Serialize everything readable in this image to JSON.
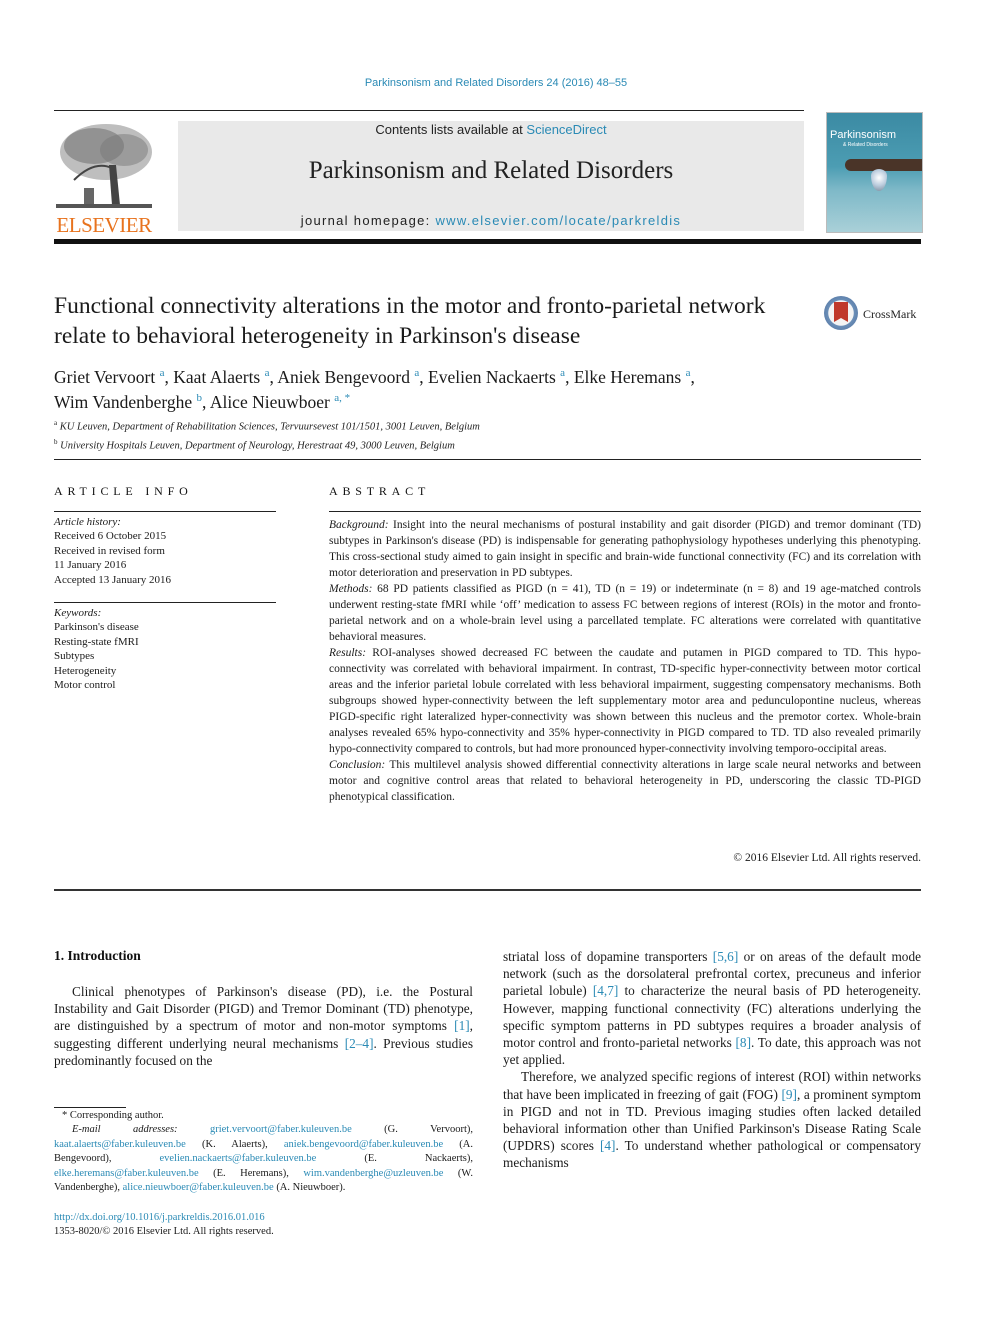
{
  "header": {
    "journal_ref": "Parkinsonism and Related Disorders 24 (2016) 48–55",
    "contents_prefix": "Contents lists available at ",
    "contents_link": "ScienceDirect",
    "journal_title": "Parkinsonism and Related Disorders",
    "homepage_prefix": "journal homepage: ",
    "homepage_link": "www.elsevier.com/locate/parkreldis",
    "publisher_logo_text": "ELSEVIER",
    "cover_title": "Parkinsonism",
    "cover_subtitle": "& Related Disorders"
  },
  "article": {
    "title": "Functional connectivity alterations in the motor and fronto-parietal network relate to behavioral heterogeneity in Parkinson's disease",
    "crossmark_label": "CrossMark",
    "authors": [
      {
        "name": "Griet Vervoort",
        "aff": "a",
        "sep": ", "
      },
      {
        "name": "Kaat Alaerts",
        "aff": "a",
        "sep": ", "
      },
      {
        "name": "Aniek Bengevoord",
        "aff": "a",
        "sep": ", "
      },
      {
        "name": "Evelien Nackaerts",
        "aff": "a",
        "sep": ", "
      },
      {
        "name": "Elke Heremans",
        "aff": "a",
        "sep": ","
      },
      {
        "name": "Wim Vandenberghe",
        "aff": "b",
        "sep": ", "
      },
      {
        "name": "Alice Nieuwboer",
        "aff": "a, *",
        "sep": ""
      }
    ],
    "affiliations": [
      {
        "key": "a",
        "text": "KU Leuven, Department of Rehabilitation Sciences, Tervuursevest 101/1501, 3001 Leuven, Belgium"
      },
      {
        "key": "b",
        "text": "University Hospitals Leuven, Department of Neurology, Herestraat 49, 3000 Leuven, Belgium"
      }
    ]
  },
  "article_info": {
    "heading": "ARTICLE INFO",
    "history_label": "Article history:",
    "history": [
      "Received 6 October 2015",
      "Received in revised form",
      "11 January 2016",
      "Accepted 13 January 2016"
    ],
    "keywords_label": "Keywords:",
    "keywords": [
      "Parkinson's disease",
      "Resting-state fMRI",
      "Subtypes",
      "Heterogeneity",
      "Motor control"
    ]
  },
  "abstract": {
    "heading": "ABSTRACT",
    "sections": [
      {
        "label": "Background:",
        "text": " Insight into the neural mechanisms of postural instability and gait disorder (PIGD) and tremor dominant (TD) subtypes in Parkinson's disease (PD) is indispensable for generating pathophysiology hypotheses underlying this phenotyping. This cross-sectional study aimed to gain insight in specific and brain-wide functional connectivity (FC) and its correlation with motor deterioration and preservation in PD subtypes."
      },
      {
        "label": "Methods:",
        "text": " 68 PD patients classified as PIGD (n = 41), TD (n = 19) or indeterminate (n = 8) and 19 age-matched controls underwent resting-state fMRI while ‘off’ medication to assess FC between regions of interest (ROIs) in the motor and fronto-parietal network and on a whole-brain level using a parcellated template. FC alterations were correlated with quantitative behavioral measures."
      },
      {
        "label": "Results:",
        "text": " ROI-analyses showed decreased FC between the caudate and putamen in PIGD compared to TD. This hypo-connectivity was correlated with behavioral impairment. In contrast, TD-specific hyper-connectivity between motor cortical areas and the inferior parietal lobule correlated with less behavioral impairment, suggesting compensatory mechanisms. Both subgroups showed hyper-connectivity between the left supplementary motor area and pedunculopontine nucleus, whereas PIGD-specific right lateralized hyper-connectivity was shown between this nucleus and the premotor cortex. Whole-brain analyses revealed 65% hypo-connectivity and 35% hyper-connectivity in PIGD compared to TD. TD also revealed primarily hypo-connectivity compared to controls, but had more pronounced hyper-connectivity involving temporo-occipital areas."
      },
      {
        "label": "Conclusion:",
        "text": " This multilevel analysis showed differential connectivity alterations in large scale neural networks and between motor and cognitive control areas that related to behavioral heterogeneity in PD, underscoring the classic TD-PIGD phenotypical classification."
      }
    ],
    "copyright": "© 2016 Elsevier Ltd. All rights reserved."
  },
  "introduction": {
    "heading": "1.  Introduction",
    "col1_p1": [
      {
        "t": "Clinical phenotypes of Parkinson's disease (PD), i.e. the Postural Instability and Gait Disorder (PIGD) and Tremor Dominant (TD) phenotype, are distinguished by a spectrum of motor and non-motor symptoms "
      },
      {
        "ref": "[1]"
      },
      {
        "t": ", suggesting different underlying neural mechanisms "
      },
      {
        "ref": "[2–4]"
      },
      {
        "t": ". Previous studies predominantly focused on the"
      }
    ],
    "col2_p1": [
      {
        "t": "striatal loss of dopamine transporters "
      },
      {
        "ref": "[5,6]"
      },
      {
        "t": " or on areas of the default mode network (such as the dorsolateral prefrontal cortex, precuneus and inferior parietal lobule) "
      },
      {
        "ref": "[4,7]"
      },
      {
        "t": " to characterize the neural basis of PD heterogeneity. However, mapping functional connectivity (FC) alterations underlying the specific symptom patterns in PD subtypes requires a broader analysis of motor control and fronto-parietal networks "
      },
      {
        "ref": "[8]"
      },
      {
        "t": ". To date, this approach was not yet applied."
      }
    ],
    "col2_p2": [
      {
        "t": "Therefore, we analyzed specific regions of interest (ROI) within networks that have been implicated in freezing of gait (FOG) "
      },
      {
        "ref": "[9]"
      },
      {
        "t": ", a prominent symptom in PIGD and not in TD. Previous imaging studies often lacked detailed behavioral information other than Unified Parkinson's Disease Rating Scale (UPDRS) scores "
      },
      {
        "ref": "[4]"
      },
      {
        "t": ". To understand whether pathological or compensatory mechanisms"
      }
    ]
  },
  "footnotes": {
    "corresponding": "* Corresponding author.",
    "email_label": "E-mail addresses:",
    "emails": [
      {
        "email": "griet.vervoort@faber.kuleuven.be",
        "who": " (G. Vervoort), "
      },
      {
        "email": "kaat.alaerts@faber.kuleuven.be",
        "who": " (K. Alaerts), "
      },
      {
        "email": "aniek.bengevoord@faber.kuleuven.be",
        "who": " (A. Bengevoord), "
      },
      {
        "email": "evelien.nackaerts@faber.kuleuven.be",
        "who": " (E. Nackaerts), "
      },
      {
        "email": "elke.heremans@faber.kuleuven.be",
        "who": " (E. Heremans), "
      },
      {
        "email": "wim.vandenberghe@uzleuven.be",
        "who": " (W. Vandenberghe), "
      },
      {
        "email": "alice.nieuwboer@faber.kuleuven.be",
        "who": " (A. Nieuwboer)."
      }
    ],
    "doi": "http://dx.doi.org/10.1016/j.parkreldis.2016.01.016",
    "issn": "1353-8020/© 2016 Elsevier Ltd. All rights reserved."
  }
}
